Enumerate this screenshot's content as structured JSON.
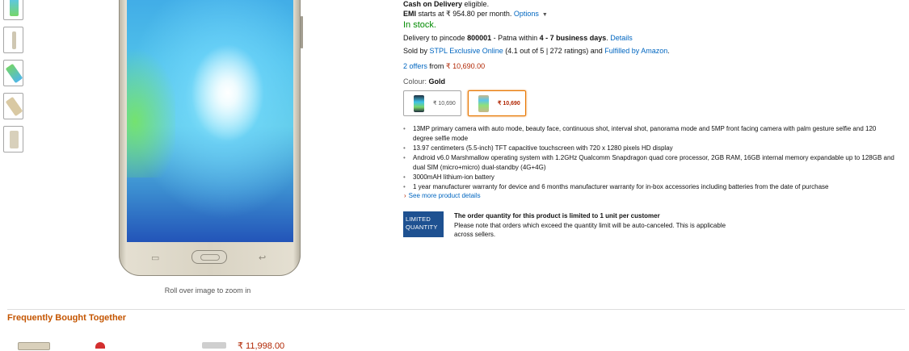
{
  "availability": {
    "cod": {
      "label": "Cash on Delivery",
      "suffix": "eligible."
    },
    "emi": {
      "label": "EMI",
      "text": "starts at ₹ 954.80 per month.",
      "options_link": "Options"
    },
    "stock_status": "In stock.",
    "delivery": {
      "prefix": "Delivery to pincode",
      "pincode": "800001",
      "mid": "- Patna within",
      "days": "4 - 7 business days",
      "details_link": "Details"
    },
    "seller": {
      "prefix": "Sold by",
      "name": "STPL Exclusive Online",
      "rating_text": "(4.1 out of 5 |",
      "ratings_count": "272 ratings) and",
      "fulfilled_link": "Fulfilled by Amazon"
    },
    "offers": {
      "link": "2 offers",
      "text": "from",
      "price": "₹ 10,690.00"
    },
    "colour": {
      "label": "Colour:",
      "value": "Gold"
    }
  },
  "swatches": [
    {
      "price": "₹ 10,690",
      "selected": false,
      "color": "#1f2d3d"
    },
    {
      "price": "₹ 10,690",
      "selected": true,
      "color": "#c8b98a"
    }
  ],
  "features": [
    "13MP primary camera with auto mode, beauty face, continuous shot, interval shot, panorama mode and 5MP front facing camera with palm gesture selfie and 120 degree selfie mode",
    "13.97 centimeters (5.5-inch) TFT capacitive touchscreen with 720 x 1280 pixels HD display",
    "Android v6.0 Marshmallow operating system with 1.2GHz Qualcomm Snapdragon quad core processor, 2GB RAM, 16GB internal memory expandable up to 128GB and dual SIM (micro+micro) dual-standby (4G+4G)",
    "3000mAH lithium-ion battery",
    "1 year manufacturer warranty for device and 6 months manufacturer warranty for in-box accessories including batteries from the date of purchase"
  ],
  "see_more": "See more product details",
  "limited": {
    "badge_line1": "LIMITED",
    "badge_line2": "QUANTITY",
    "title": "The order quantity for this product is limited to 1 unit per customer",
    "body": "Please note that orders which exceed the quantity limit will be auto-canceled. This is applicable across sellers."
  },
  "image": {
    "zoom_hint": "Roll over image to zoom in"
  },
  "frequently_bought": {
    "title": "Frequently Bought Together",
    "price": "₹ 11,998.00"
  },
  "colors": {
    "link": "#0066c0",
    "price": "#b12704",
    "in_stock": "#008a00",
    "section_title": "#c45500",
    "selected_border": "#e77600"
  }
}
